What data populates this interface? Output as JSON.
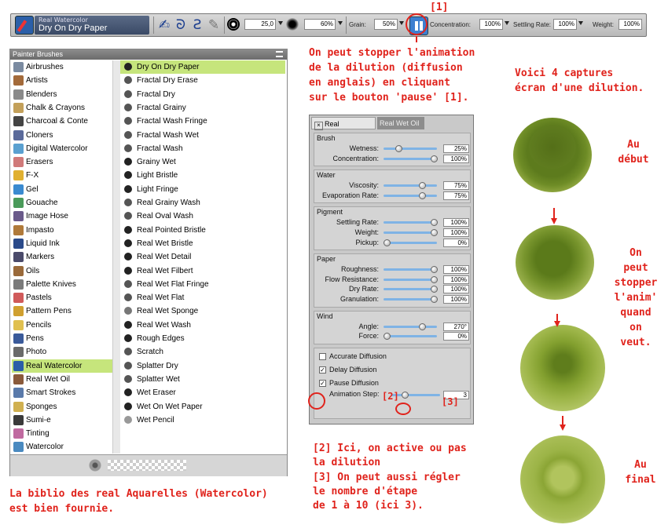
{
  "toolbar": {
    "category": "Real Watercolor",
    "variant": "Dry On Dry Paper",
    "size_value": "25,0",
    "opacity_value": "60%",
    "grain_label": "Grain:",
    "grain_value": "50%",
    "concentration_label": "Concentration:",
    "concentration_value": "100%",
    "settling_label": "Settling Rate:",
    "settling_value": "100%",
    "weight_label": "Weight:",
    "weight_value": "100%"
  },
  "annotations": {
    "marker1": "[1]",
    "marker2": "[2]",
    "marker3": "[3]",
    "pause_note": "On peut stopper l'animation\nde la dilution (diffusion\nen anglais) en cliquant\nsur le bouton 'pause' [1].",
    "captures_note": "Voici 4 captures\nécran d'une dilution.",
    "library_note": "La biblio des real Aquarelles (Watercolor)\nest bien fournie.",
    "options_note_a": "[2] Ici, on active ou pas\nla dilution",
    "options_note_b": "[3] On peut aussi régler\nle nombre d'étape\nde 1 à 10 (ici 3).",
    "stage_start": "Au\ndébut",
    "stage_pause": "On\npeut\nstopper\nl'anim'\nquand\non\nveut.",
    "stage_end": "Au\nfinal"
  },
  "brush_panel": {
    "title": "Painter Brushes",
    "categories": [
      {
        "label": "Airbrushes",
        "color": "#7a8aa0"
      },
      {
        "label": "Artists",
        "color": "#a36a3a"
      },
      {
        "label": "Blenders",
        "color": "#8a8a8a"
      },
      {
        "label": "Chalk & Crayons",
        "color": "#c3a05a"
      },
      {
        "label": "Charcoal & Conte",
        "color": "#444444"
      },
      {
        "label": "Cloners",
        "color": "#5a6a9a"
      },
      {
        "label": "Digital Watercolor",
        "color": "#5aa0d0"
      },
      {
        "label": "Erasers",
        "color": "#d07a7a"
      },
      {
        "label": "F-X",
        "color": "#e0b030"
      },
      {
        "label": "Gel",
        "color": "#3a8ad0"
      },
      {
        "label": "Gouache",
        "color": "#4a9a5a"
      },
      {
        "label": "Image Hose",
        "color": "#6a5a8a"
      },
      {
        "label": "Impasto",
        "color": "#b07a3a"
      },
      {
        "label": "Liquid Ink",
        "color": "#2a4a8a"
      },
      {
        "label": "Markers",
        "color": "#4a4a6a"
      },
      {
        "label": "Oils",
        "color": "#9a6a3a"
      },
      {
        "label": "Palette Knives",
        "color": "#7a7a7a"
      },
      {
        "label": "Pastels",
        "color": "#d05a5a"
      },
      {
        "label": "Pattern Pens",
        "color": "#d0a030"
      },
      {
        "label": "Pencils",
        "color": "#e0c050"
      },
      {
        "label": "Pens",
        "color": "#3a5a9a"
      },
      {
        "label": "Photo",
        "color": "#6a6a6a"
      },
      {
        "label": "Real Watercolor",
        "color": "#2b5fa8"
      },
      {
        "label": "Real Wet Oil",
        "color": "#8a5a3a"
      },
      {
        "label": "Smart Strokes",
        "color": "#5a7aaa"
      },
      {
        "label": "Sponges",
        "color": "#d0b050"
      },
      {
        "label": "Sumi-e",
        "color": "#3a3a3a"
      },
      {
        "label": "Tinting",
        "color": "#c06aa0"
      },
      {
        "label": "Watercolor",
        "color": "#4a8ac0"
      }
    ],
    "selected_category": "Real Watercolor",
    "variants": [
      {
        "label": "Dry On Dry Paper",
        "dot": "#222"
      },
      {
        "label": "Fractal Dry Erase",
        "dot": "#555"
      },
      {
        "label": "Fractal Dry",
        "dot": "#555"
      },
      {
        "label": "Fractal Grainy",
        "dot": "#555"
      },
      {
        "label": "Fractal Wash Fringe",
        "dot": "#555"
      },
      {
        "label": "Fractal Wash Wet",
        "dot": "#555"
      },
      {
        "label": "Fractal Wash",
        "dot": "#555"
      },
      {
        "label": "Grainy Wet",
        "dot": "#222"
      },
      {
        "label": "Light Bristle",
        "dot": "#222"
      },
      {
        "label": "Light Fringe",
        "dot": "#222"
      },
      {
        "label": "Real Grainy Wash",
        "dot": "#555"
      },
      {
        "label": "Real Oval Wash",
        "dot": "#555"
      },
      {
        "label": "Real Pointed Bristle",
        "dot": "#222"
      },
      {
        "label": "Real Wet Bristle",
        "dot": "#222"
      },
      {
        "label": "Real Wet Detail",
        "dot": "#222"
      },
      {
        "label": "Real Wet Filbert",
        "dot": "#222"
      },
      {
        "label": "Real Wet Flat Fringe",
        "dot": "#555"
      },
      {
        "label": "Real Wet Flat",
        "dot": "#555"
      },
      {
        "label": "Real Wet Sponge",
        "dot": "#777"
      },
      {
        "label": "Real Wet Wash",
        "dot": "#222"
      },
      {
        "label": "Rough Edges",
        "dot": "#222"
      },
      {
        "label": "Scratch",
        "dot": "#555"
      },
      {
        "label": "Splatter Dry",
        "dot": "#555"
      },
      {
        "label": "Splatter Wet",
        "dot": "#555"
      },
      {
        "label": "Wet Eraser",
        "dot": "#222"
      },
      {
        "label": "Wet On Wet Paper",
        "dot": "#222"
      },
      {
        "label": "Wet Pencil",
        "dot": "#999"
      }
    ],
    "selected_variant": "Dry On Dry Paper"
  },
  "wc_panel": {
    "tab_active": "Real Watercolor",
    "tab_inactive": "Real Wet Oil",
    "sections": [
      {
        "title": "Brush",
        "rows": [
          {
            "label": "Wetness:",
            "value": "25%",
            "level": 0.25
          },
          {
            "label": "Concentration:",
            "value": "100%",
            "level": 1.0
          }
        ]
      },
      {
        "title": "Water",
        "rows": [
          {
            "label": "Viscosity:",
            "value": "75%",
            "level": 0.75
          },
          {
            "label": "Evaporation Rate:",
            "value": "75%",
            "level": 0.75
          }
        ]
      },
      {
        "title": "Pigment",
        "rows": [
          {
            "label": "Settling Rate:",
            "value": "100%",
            "level": 1.0
          },
          {
            "label": "Weight:",
            "value": "100%",
            "level": 1.0
          },
          {
            "label": "Pickup:",
            "value": "0%",
            "level": 0.0
          }
        ]
      },
      {
        "title": "Paper",
        "rows": [
          {
            "label": "Roughness:",
            "value": "100%",
            "level": 1.0
          },
          {
            "label": "Flow Resistance:",
            "value": "100%",
            "level": 1.0
          },
          {
            "label": "Dry Rate:",
            "value": "100%",
            "level": 1.0
          },
          {
            "label": "Granulation:",
            "value": "100%",
            "level": 1.0
          }
        ]
      },
      {
        "title": "Wind",
        "rows": [
          {
            "label": "Angle:",
            "value": "270°",
            "level": 0.75
          },
          {
            "label": "Force:",
            "value": "0%",
            "level": 0.0
          }
        ]
      }
    ],
    "options": [
      {
        "label": "Accurate Diffusion",
        "checked": false
      },
      {
        "label": "Delay Diffusion",
        "checked": true
      },
      {
        "label": "Pause Diffusion",
        "checked": true
      }
    ],
    "animation_step_label": "Animation Step:",
    "animation_step_value": "3",
    "animation_step_level": 0.25
  },
  "colors": {
    "accent_red": "#e0231c",
    "selection_green": "#c6e57c",
    "paint_green": "#7d9a2a"
  }
}
